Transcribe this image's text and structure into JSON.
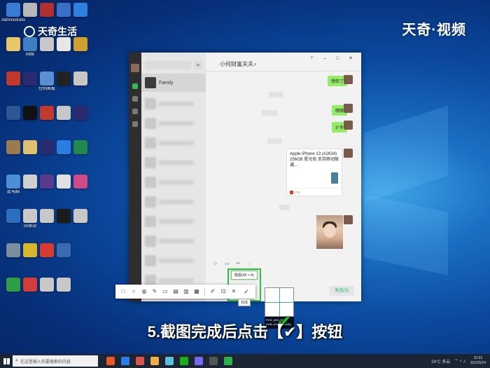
{
  "watermark": {
    "left_brand": "天奇生活",
    "right_brand": "天奇·视频"
  },
  "desktop_icons": [
    {
      "label": "Administrator",
      "color": "#3a7bd5"
    },
    {
      "label": "",
      "color": "#e8c66a"
    },
    {
      "label": "",
      "color": "#c0392b"
    },
    {
      "label": "",
      "color": "#2b5797"
    },
    {
      "label": "",
      "color": "#9a7b4f"
    },
    {
      "label": "此电脑",
      "color": "#4a90d9"
    },
    {
      "label": "",
      "color": "#2d6fbf"
    },
    {
      "label": "",
      "color": "#7d8da0"
    },
    {
      "label": "",
      "color": "#2e9e46"
    },
    {
      "label": "",
      "color": "#b8b8b8"
    },
    {
      "label": "网络",
      "color": "#3d7fc1"
    },
    {
      "label": "",
      "color": "#2a2a6e"
    },
    {
      "label": "",
      "color": "#111111"
    },
    {
      "label": "",
      "color": "#e0c070"
    },
    {
      "label": "",
      "color": "#d0d0d0"
    },
    {
      "label": "回收站",
      "color": "#c8c8c8"
    },
    {
      "label": "",
      "color": "#d6b82a"
    },
    {
      "label": "",
      "color": "#d43c3c"
    },
    {
      "label": "",
      "color": "#b03030"
    },
    {
      "label": "",
      "color": "#c8c8c8"
    },
    {
      "label": "控制面板",
      "color": "#5b8fd1"
    },
    {
      "label": "",
      "color": "#c23b2a"
    },
    {
      "label": "",
      "color": "#2a2a6e"
    },
    {
      "label": "",
      "color": "#5a3a8e"
    },
    {
      "label": "",
      "color": "#c8c8c8"
    },
    {
      "label": "",
      "color": "#d73a2e"
    },
    {
      "label": "",
      "color": "#c8c8c8"
    },
    {
      "label": "",
      "color": "#3b6fc5"
    },
    {
      "label": "",
      "color": "#e7e7e7"
    },
    {
      "label": "",
      "color": "#222222"
    },
    {
      "label": "",
      "color": "#c8c8c8"
    },
    {
      "label": "",
      "color": "#2a7de1"
    },
    {
      "label": "",
      "color": "#e0e0e0"
    },
    {
      "label": "",
      "color": "#1c1c1c"
    },
    {
      "label": "",
      "color": "#3a6ab0"
    },
    {
      "label": "",
      "color": "#c8c8c8"
    },
    {
      "label": "",
      "color": "#2d7fe0"
    },
    {
      "label": "",
      "color": "#d0a030"
    },
    {
      "label": "",
      "color": "#c8c8c8"
    },
    {
      "label": "",
      "color": "#2a2a6e"
    },
    {
      "label": "",
      "color": "#1f8a4c"
    },
    {
      "label": "",
      "color": "#d04a8a"
    },
    {
      "label": "",
      "color": "#c8c8c8"
    }
  ],
  "chat_window": {
    "contact_title": "小何财富夫夫♪",
    "first_chat_name": "Family",
    "send_button": "发送(S)",
    "messages": [
      {
        "text": "想你了"
      },
      {
        "text": "哦哦"
      },
      {
        "text": "3°多"
      }
    ],
    "product_card": {
      "title": "Apple iPhone 13 (A2634) 256GB 星光色 支持移动联通...",
      "source": "京东"
    }
  },
  "capture_toolbar": {
    "tooltip": "截图(Alt + A)",
    "done_tooltip": "完成",
    "pixel_info": "POS: (925,395)  RGB: (245,245,245)"
  },
  "subtitle": "5.截图完成后点击【✔】按钮",
  "taskbar": {
    "search_placeholder": "在这里输入你要搜索的内容",
    "weather": "24°C 多云",
    "time": "10:53",
    "date": "2022/5/24",
    "colors": [
      "#e85a2a",
      "#2b7de9",
      "#d9534f",
      "#f0ad4e",
      "#5bc0de",
      "#1aad19",
      "#7b68ee",
      "#555555",
      "#2bb24c"
    ]
  }
}
